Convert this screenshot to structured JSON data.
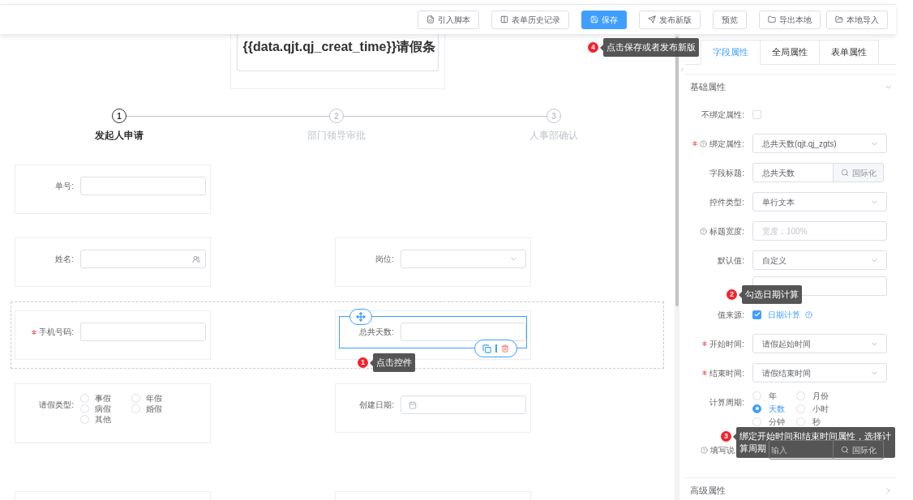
{
  "toolbar": {
    "buttons": [
      {
        "kind": "script",
        "label": "引入脚本",
        "primary": false
      },
      {
        "kind": "history",
        "label": "表单历史记录",
        "primary": false
      },
      {
        "kind": "save",
        "label": "保存",
        "primary": true
      },
      {
        "kind": "publish",
        "label": "发布新版",
        "primary": false
      },
      {
        "kind": "preview",
        "label": "预览",
        "primary": false
      },
      {
        "kind": "export",
        "label": "导出本地",
        "primary": false
      },
      {
        "kind": "import",
        "label": "本地导入",
        "primary": false
      }
    ],
    "guide": {
      "number": "4",
      "text": "点击保存或者发布新版"
    }
  },
  "canvas": {
    "title": "{{data.qjt.qj_creat_time}}请假条",
    "steps": [
      {
        "number": "1",
        "label": "发起人申请",
        "active": true
      },
      {
        "number": "2",
        "label": "部门领导审批",
        "active": false
      },
      {
        "number": "3",
        "label": "人事部确认",
        "active": false
      }
    ],
    "rows": [
      {
        "selected": false,
        "cells": [
          {
            "kind": "input",
            "label": "单号:",
            "required": false,
            "selected": false
          }
        ]
      },
      {
        "selected": false,
        "cells": [
          {
            "kind": "user",
            "label": "姓名:",
            "required": false,
            "selected": false
          },
          {
            "kind": "select",
            "label": "岗位:",
            "required": false,
            "selected": false
          }
        ]
      },
      {
        "selected": true,
        "cells": [
          {
            "kind": "input",
            "label": "手机号码:",
            "required": true,
            "selected": false
          },
          {
            "kind": "input",
            "label": "总共天数:",
            "required": false,
            "selected": true,
            "guide": {
              "number": "1",
              "text": "点击控件"
            }
          }
        ]
      },
      {
        "selected": false,
        "cells": [
          {
            "kind": "radio",
            "label": "请假类型:",
            "required": false,
            "selected": false,
            "options": [
              {
                "label": "事假",
                "selected": false
              },
              {
                "label": "年假",
                "selected": false
              },
              {
                "label": "病假",
                "selected": false
              },
              {
                "label": "婚假",
                "selected": false
              },
              {
                "label": "其他",
                "selected": false
              }
            ]
          },
          {
            "kind": "date",
            "label": "创建日期:",
            "required": false,
            "selected": false
          }
        ]
      },
      {
        "selected": false,
        "cells": [
          {
            "kind": "empty"
          },
          {
            "kind": "empty"
          }
        ]
      }
    ]
  },
  "panel": {
    "tabs": [
      {
        "label": "字段属性",
        "selected": true
      },
      {
        "label": "全局属性",
        "selected": false
      },
      {
        "label": "表单属性",
        "selected": false
      }
    ],
    "sections": [
      {
        "title": "基础属性",
        "expanded": true,
        "fields": [
          {
            "kind": "checkbox",
            "label": "不绑定属性:",
            "required": false,
            "help": false,
            "checked": false
          },
          {
            "kind": "select",
            "label": "绑定属性:",
            "required": true,
            "help": true,
            "value": "总共天数(qjt.qj_zgts)"
          },
          {
            "kind": "input-button",
            "label": "字段标题:",
            "required": false,
            "help": false,
            "value": "总共天数",
            "button": "国际化"
          },
          {
            "kind": "select",
            "label": "控件类型:",
            "required": false,
            "help": false,
            "value": "单行文本"
          },
          {
            "kind": "input",
            "label": "标题宽度:",
            "required": false,
            "help": true,
            "placeholder": "宽度：100%"
          },
          {
            "kind": "select",
            "label": "默认值:",
            "required": false,
            "help": false,
            "value": "自定义"
          },
          {
            "kind": "input",
            "required": false,
            "help": false
          },
          {
            "kind": "checkbox",
            "label": "值来源:",
            "required": false,
            "help": false,
            "checked": true,
            "text": "日期计算",
            "text_help": true,
            "guide": {
              "number": "2",
              "text": "勾选日期计算"
            }
          },
          {
            "kind": "select",
            "label": "开始时间:",
            "required": true,
            "help": false,
            "value": "请假起始时间"
          },
          {
            "kind": "select",
            "label": "结束时间:",
            "required": true,
            "help": false,
            "value": "请假结束时间"
          },
          {
            "kind": "radio",
            "label": "计算周期:",
            "required": false,
            "help": false,
            "options": [
              {
                "label": "年",
                "selected": false
              },
              {
                "label": "月份",
                "selected": false
              },
              {
                "label": "天数",
                "selected": true
              },
              {
                "label": "小时",
                "selected": false
              },
              {
                "label": "分钟",
                "selected": false
              },
              {
                "label": "秒",
                "selected": false
              }
            ],
            "guide": {
              "number": "3",
              "text": "绑定开始时间和结束时间属性，选择计算周期"
            }
          },
          {
            "kind": "input-button",
            "label": "填写说",
            "required": false,
            "help": true,
            "placeholder": "输入",
            "button": "国际化"
          }
        ]
      },
      {
        "title": "高级属性",
        "expanded": false
      }
    ]
  }
}
